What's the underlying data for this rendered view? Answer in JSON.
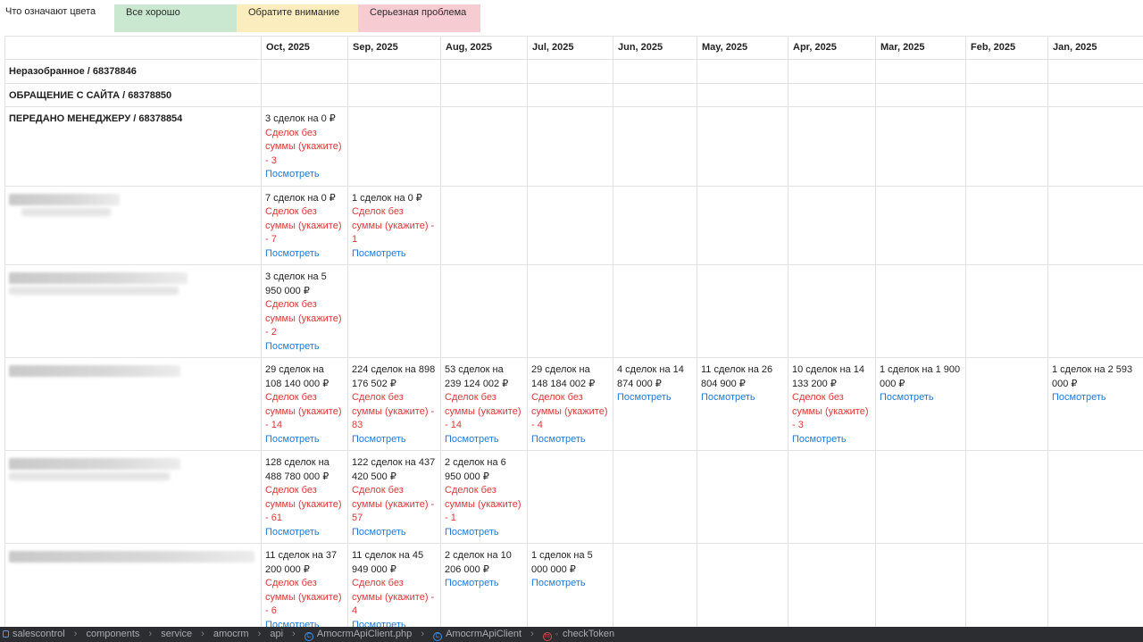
{
  "legend": {
    "title": "Что означают цвета",
    "good": "Все хорошо",
    "warn": "Обратите внимание",
    "bad": "Серьезная проблема",
    "colors": {
      "good": "#c9e8cf",
      "warn": "#fbedbd",
      "bad": "#f7cbd2"
    }
  },
  "months": [
    "Oct, 2025",
    "Sep, 2025",
    "Aug, 2025",
    "Jul, 2025",
    "Jun, 2025",
    "May, 2025",
    "Apr, 2025",
    "Mar, 2025",
    "Feb, 2025",
    "Jan, 2025"
  ],
  "stages": {
    "unsorted": "Неразобранное / 68378846",
    "site": "ОБРАЩЕНИЕ С САЙТА / 68378850",
    "manager": "ПЕРЕДАНО МЕНЕДЖЕРУ / 68378854"
  },
  "view_label": "Посмотреть",
  "rows": {
    "manager": {
      "oct": {
        "deals": "3 сделок на 0 ₽",
        "nosum": "Сделок без суммы (укажите) - 3"
      }
    },
    "b1": {
      "oct": {
        "deals": "7 сделок на 0 ₽",
        "nosum": "Сделок без суммы (укажите) - 7"
      },
      "sep": {
        "deals": "1 сделок на 0 ₽",
        "nosum": "Сделок без суммы (укажите) - 1"
      }
    },
    "b2": {
      "oct": {
        "deals": "3 сделок на 5 950 000 ₽",
        "nosum": "Сделок без суммы (укажите) - 2"
      }
    },
    "b3": {
      "oct": {
        "deals": "29 сделок на 108 140 000 ₽",
        "nosum": "Сделок без суммы (укажите) - 14"
      },
      "sep": {
        "deals": "224 сделок на 898 176 502 ₽",
        "nosum": "Сделок без суммы (укажите) - 83"
      },
      "aug": {
        "deals": "53 сделок на 239 124 002 ₽",
        "nosum": "Сделок без суммы (укажите) - 14"
      },
      "jul": {
        "deals": "29 сделок на 148 184 002 ₽",
        "nosum": "Сделок без суммы (укажите) - 4"
      },
      "jun": {
        "deals": "4 сделок на 14 874 000 ₽"
      },
      "may": {
        "deals": "11 сделок на 26 804 900 ₽"
      },
      "apr": {
        "deals": "10 сделок на 14 133 200 ₽",
        "nosum": "Сделок без суммы (укажите) - 3"
      },
      "mar": {
        "deals": "1 сделок на 1 900 000 ₽"
      },
      "jan": {
        "deals": "1 сделок на 2 593 000 ₽"
      }
    },
    "b4": {
      "oct": {
        "deals": "128 сделок на 488 780 000 ₽",
        "nosum": "Сделок без суммы (укажите) - 61"
      },
      "sep": {
        "deals": "122 сделок на 437 420 500 ₽",
        "nosum": "Сделок без суммы (укажите) - 57"
      },
      "aug": {
        "deals": "2 сделок на 6 950 000 ₽",
        "nosum": "Сделок без суммы (укажите) - 1"
      }
    },
    "b5": {
      "oct": {
        "deals": "11 сделок на 37 200 000 ₽",
        "nosum": "Сделок без суммы (укажите) - 6"
      },
      "sep": {
        "deals": "11 сделок на 45 949 000 ₽",
        "nosum": "Сделок без суммы (укажите) - 4"
      },
      "aug": {
        "deals": "2 сделок на 10 206 000 ₽"
      },
      "jul": {
        "deals": "1 сделок на 5 000 000 ₽"
      }
    }
  },
  "breadcrumb": [
    "salescontrol",
    "components",
    "service",
    "amocrm",
    "api",
    "AmocrmApiClient.php",
    "AmocrmApiClient",
    "checkToken"
  ],
  "icons": [
    "folder-icon",
    "class-icon",
    "method-icon",
    "lock-icon"
  ],
  "statusbar_colors": {
    "bg": "#2b2d30",
    "text": "#a8abb0"
  }
}
